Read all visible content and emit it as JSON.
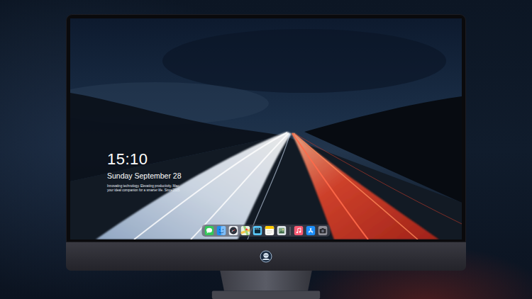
{
  "desktop": {
    "clock": {
      "time": "15:10",
      "date": "Sunday September 28",
      "tagline": "Innovating technology. Elevating productivity. Mac, your ideal companion for a smarter life. Since2025"
    }
  },
  "dock": {
    "apps": [
      {
        "kind": "messages"
      },
      {
        "kind": "finder"
      },
      {
        "kind": "safari"
      },
      {
        "kind": "maps"
      },
      {
        "kind": "clapper"
      },
      {
        "kind": "notes"
      },
      {
        "kind": "photos"
      },
      {
        "kind": "divider"
      },
      {
        "kind": "music"
      },
      {
        "kind": "appstore"
      },
      {
        "kind": "camera"
      }
    ]
  }
}
